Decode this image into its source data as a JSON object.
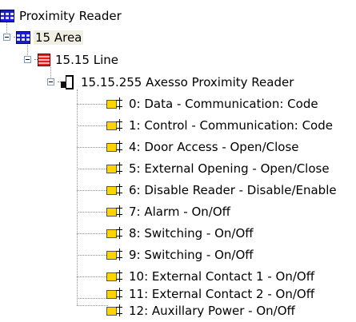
{
  "tree": {
    "root": {
      "label": "Proximity Reader",
      "icon": "building-grid-icon"
    },
    "area": {
      "label": "15 Area",
      "icon": "area-grid-icon",
      "expanded": true,
      "selected": true
    },
    "line": {
      "label": "15.15 Line",
      "icon": "line-icon",
      "expanded": true
    },
    "device": {
      "label": "15.15.255 Axesso Proximity Reader",
      "icon": "device-icon",
      "expanded": true
    },
    "objects": [
      {
        "label": "0: Data - Communication: Code"
      },
      {
        "label": "1: Control - Communication: Code"
      },
      {
        "label": "4: Door Access - Open/Close"
      },
      {
        "label": "5: External Opening - Open/Close"
      },
      {
        "label": "6: Disable Reader - Disable/Enable"
      },
      {
        "label": "7: Alarm - On/Off"
      },
      {
        "label": "8: Switching - On/Off"
      },
      {
        "label": "9: Switching - On/Off"
      },
      {
        "label": "10: External Contact 1 - On/Off"
      },
      {
        "label": "11: External Contact 2 - On/Off"
      },
      {
        "label": "12: Auxillary Power - On/Off"
      }
    ]
  },
  "colors": {
    "selection_bg": "#f1efe2",
    "connector": "#8c8c8c",
    "object_yellow": "#ffd400",
    "grid_blue": "#1c1cd8",
    "line_red": "#e02020"
  }
}
